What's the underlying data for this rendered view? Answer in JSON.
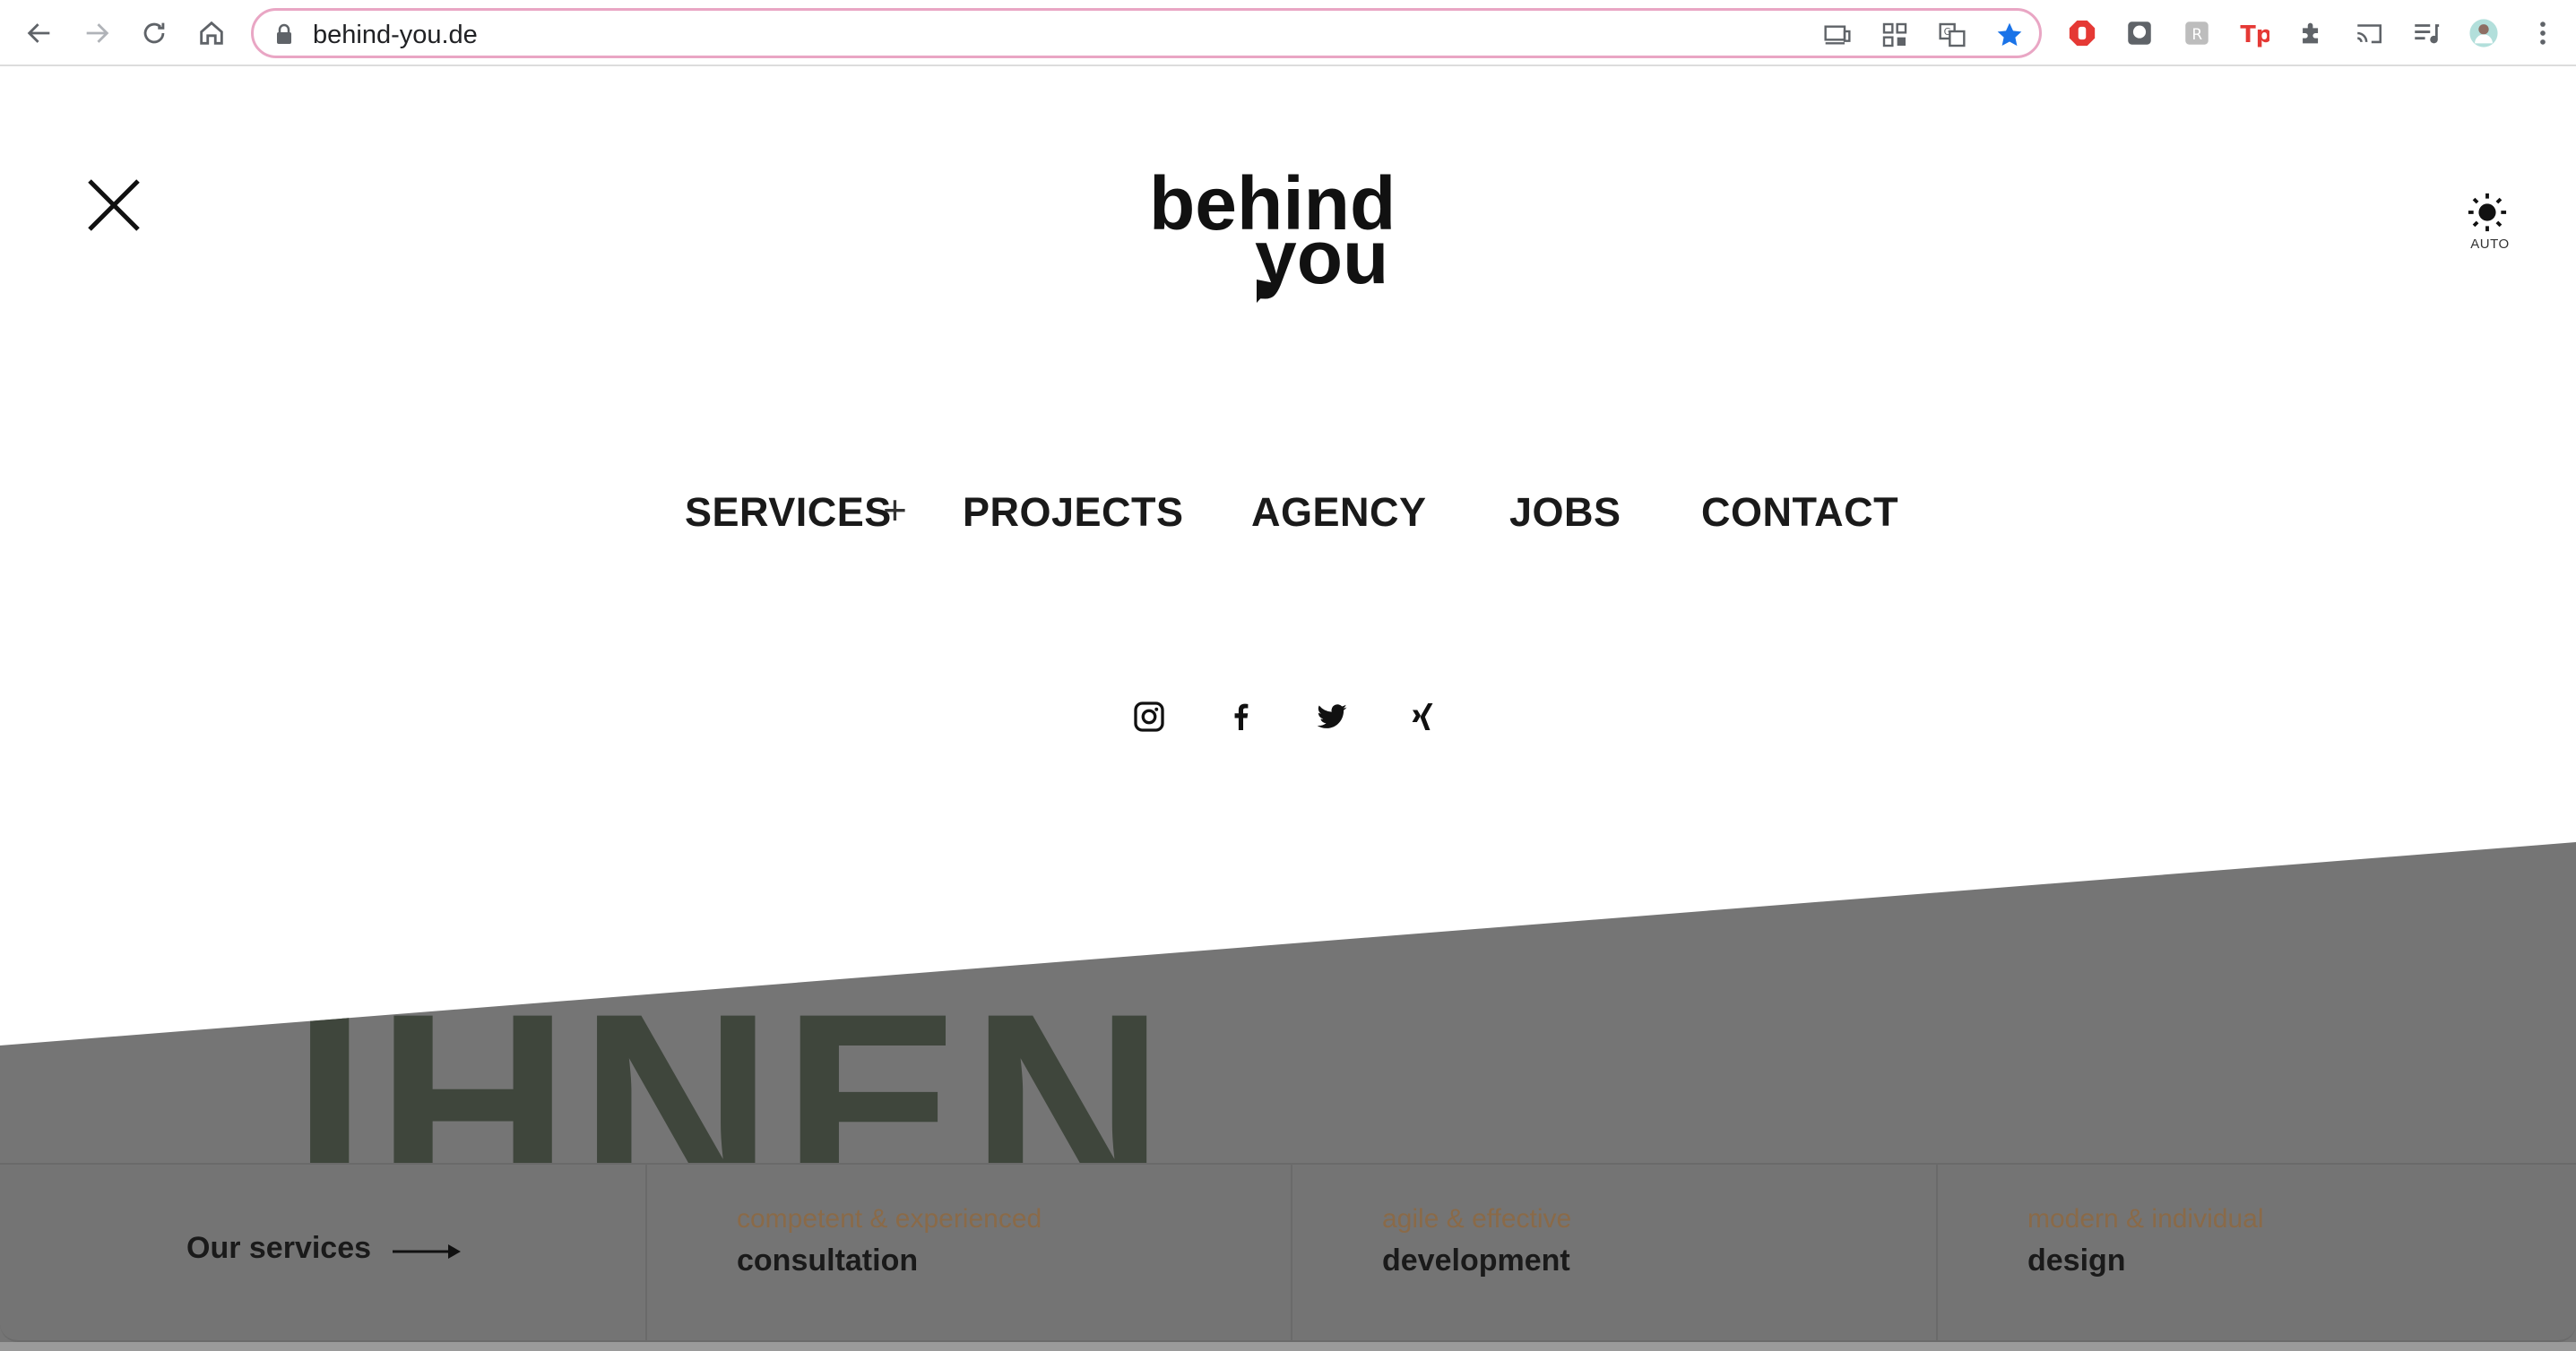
{
  "browser": {
    "url": "behind-you.de",
    "icons": {
      "back": "back-arrow-icon",
      "forward": "forward-arrow-icon",
      "reload": "reload-icon",
      "home": "home-icon",
      "lock": "lock-icon",
      "bookmark_color": "#1a73e8"
    }
  },
  "header": {
    "logo_text_top": "behind",
    "logo_text_bottom": "you",
    "theme_label": "AUTO"
  },
  "nav": {
    "items": [
      "SERVICES",
      "PROJECTS",
      "AGENCY",
      "JOBS",
      "CONTACT"
    ],
    "expand_symbol": "+"
  },
  "hero": {
    "word": "IHNEN"
  },
  "services_bar": {
    "intro": "Our services",
    "items": [
      {
        "subtitle": "competent & experienced",
        "title": "consultation"
      },
      {
        "subtitle": "agile & effective",
        "title": "development"
      },
      {
        "subtitle": "modern & individual",
        "title": "design"
      }
    ]
  },
  "colors": {
    "accent": "#8a6a48",
    "hero_gray": "#757575",
    "text": "#1a1a1a"
  }
}
